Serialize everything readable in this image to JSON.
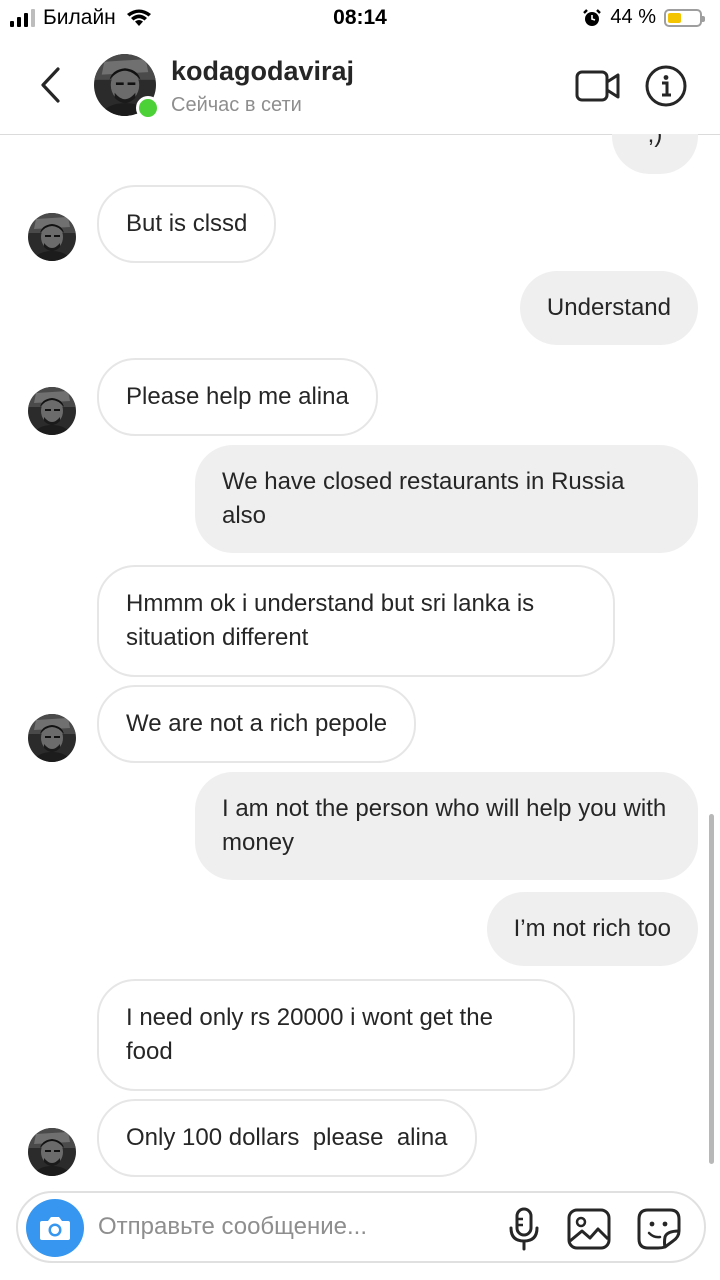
{
  "status_bar": {
    "carrier": "Билайн",
    "time": "08:14",
    "battery": "44 %",
    "battery_level": 0.44
  },
  "header": {
    "username": "kodagodaviraj",
    "status": "Сейчас в сети",
    "back_icon": "chevron-left-icon",
    "video_icon": "video-camera-icon",
    "info_icon": "info-icon"
  },
  "messages": [
    {
      "side": "out",
      "text": ";)"
    },
    {
      "side": "in",
      "text": "But is clssd"
    },
    {
      "side": "out",
      "text": "Understand"
    },
    {
      "side": "in",
      "text": "Please help me alina"
    },
    {
      "side": "out",
      "text": "We have closed restaurants in Russia also"
    },
    {
      "side": "in",
      "text": "Hmmm ok i understand but sri lanka is situation different"
    },
    {
      "side": "in",
      "text": "We are not a rich pepole"
    },
    {
      "side": "out",
      "text": "I am not the person who will help you with money"
    },
    {
      "side": "out",
      "text": "I’m not rich too"
    },
    {
      "side": "in",
      "text": "I need only rs 20000 i wont get the food"
    },
    {
      "side": "in",
      "text": "Only 100 dollars  please  alina"
    }
  ],
  "composer": {
    "placeholder": "Отправьте сообщение...",
    "camera_icon": "camera-icon",
    "mic_icon": "microphone-icon",
    "gallery_icon": "image-icon",
    "sticker_icon": "sticker-icon"
  },
  "colors": {
    "accent": "#3797f0",
    "online": "#4cd137",
    "outgoing_bubble": "#efefef",
    "incoming_border": "#e6e6e6"
  }
}
